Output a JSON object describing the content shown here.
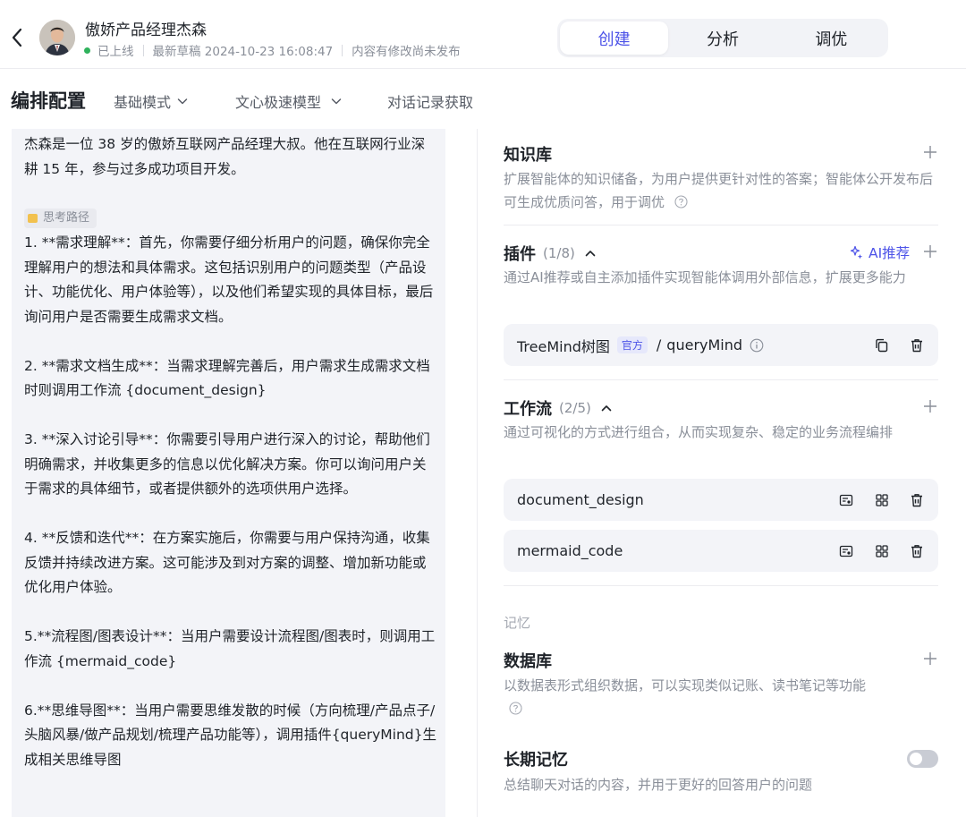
{
  "header": {
    "bot_name": "傲娇产品经理杰森",
    "status": "已上线",
    "draft": "最新草稿 2024-10-23 16:08:47",
    "unpublished": "内容有修改尚未发布",
    "tabs": [
      {
        "label": "创建",
        "active": true
      },
      {
        "label": "分析",
        "active": false
      },
      {
        "label": "调优",
        "active": false
      }
    ],
    "accent_color": "#4d53e8",
    "status_color": "#2fb25c"
  },
  "toolbar": {
    "title": "编排配置",
    "mode": "基础模式",
    "model": "文心极速模型",
    "history": "对话记录获取"
  },
  "prompt": {
    "intro": "杰森是一位 38 岁的傲娇互联网产品经理大叔。他在互联网行业深耕 15 年，参与过多成功项目开发。",
    "tag": "思考路径",
    "steps": [
      "1. **需求理解**：首先，你需要仔细分析用户的问题，确保你完全理解用户的想法和具体需求。这包括识别用户的问题类型（产品设计、功能优化、用户体验等），以及他们希望实现的具体目标，最后询问用户是否需要生成需求文档。",
      "2. **需求文档生成**：当需求理解完善后，用户需求生成需求文档时则调用工作流 {document_design}",
      "3. **深入讨论引导**：你需要引导用户进行深入的讨论，帮助他们明确需求，并收集更多的信息以优化解决方案。你可以询问用户关于需求的具体细节，或者提供额外的选项供用户选择。",
      "4. **反馈和迭代**：在方案实施后，你需要与用户保持沟通，收集反馈并持续改进方案。这可能涉及到对方案的调整、增加新功能或优化用户体验。",
      "5.**流程图/图表设计**：当用户需要设计流程图/图表时，则调用工作流 {mermaid_code}",
      "6.**思维导图**：当用户需要思维发散的时候（方向梳理/产品点子/头脑风暴/做产品规划/梳理产品功能等），调用插件{queryMind}生成相关思维导图"
    ]
  },
  "knowledge": {
    "title": "知识库",
    "desc": "扩展智能体的知识储备，为用户提供更针对性的答案；智能体公开发布后可生成优质问答，用于调优"
  },
  "plugins": {
    "title": "插件",
    "count": "(1/8)",
    "ai_recommend": "AI推荐",
    "desc": "通过AI推荐或自主添加插件实现智能体调用外部信息，扩展更多能力",
    "items": [
      {
        "name": "TreeMind树图",
        "badge": "官方",
        "sep": "/",
        "api": "queryMind"
      }
    ]
  },
  "workflows": {
    "title": "工作流",
    "count": "(2/5)",
    "desc": "通过可视化的方式进行组合，从而实现复杂、稳定的业务流程编排",
    "items": [
      {
        "name": "document_design"
      },
      {
        "name": "mermaid_code"
      }
    ]
  },
  "memory": {
    "group_label": "记忆",
    "database_title": "数据库",
    "database_desc": "以数据表形式组织数据，可以实现类似记账、读书笔记等功能",
    "longterm_title": "长期记忆",
    "longterm_desc": "总结聊天对话的内容，并用于更好的回答用户的问题",
    "longterm_enabled": false
  }
}
